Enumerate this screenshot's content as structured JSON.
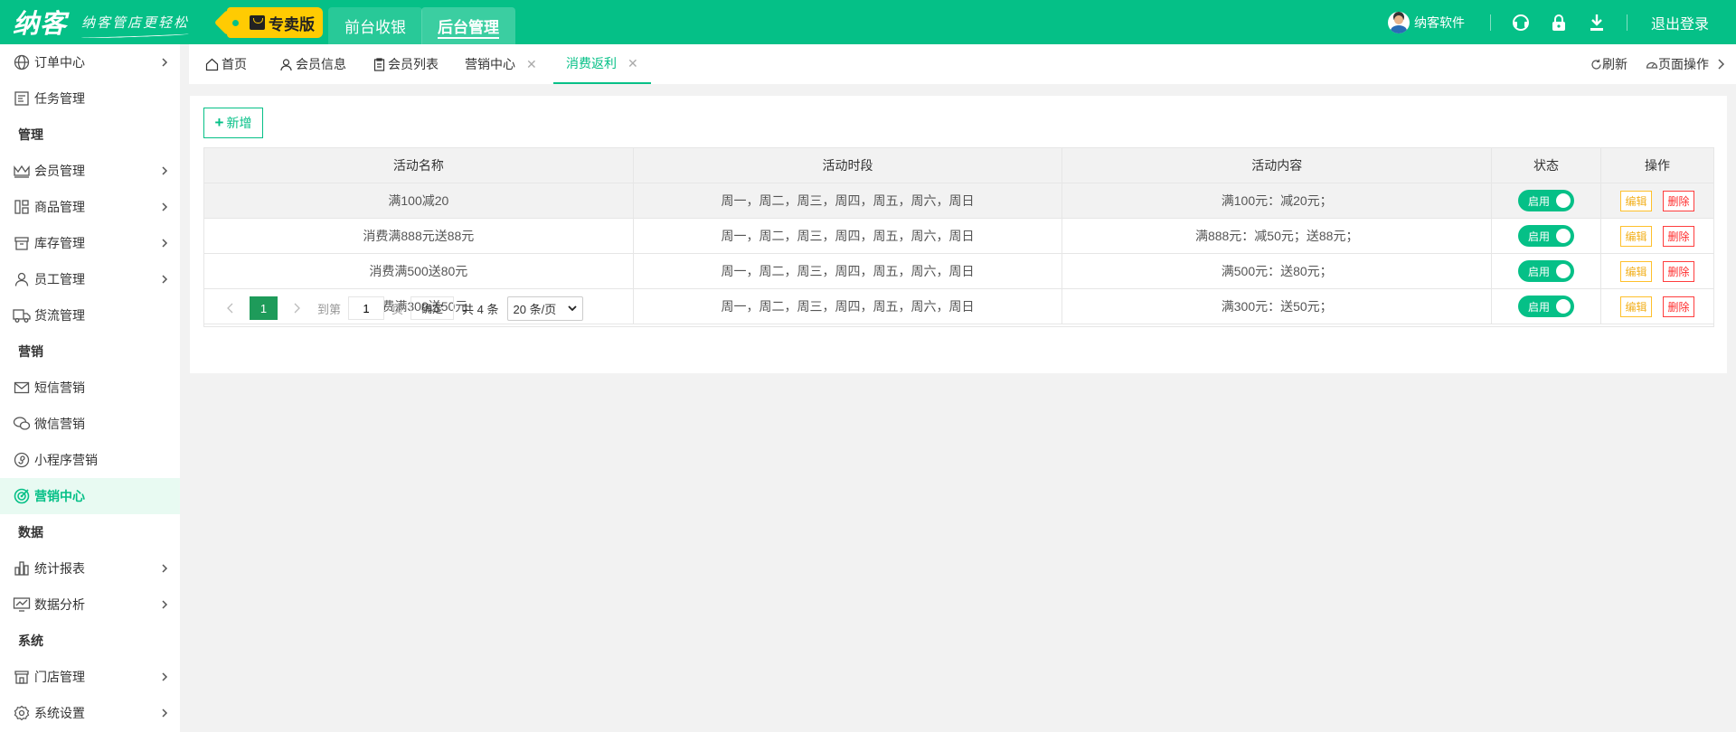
{
  "topbar": {
    "logo": "纳客",
    "slogan": "纳客管店更轻松",
    "edition": "专卖版",
    "tabs": [
      "前台收银",
      "后台管理"
    ],
    "user_name": "纳客软件",
    "logout": "退出登录",
    "accent_color": "#05c087"
  },
  "sidebar": {
    "items": [
      {
        "label": "订单中心",
        "icon": "globe-icon"
      },
      {
        "label": "任务管理",
        "icon": "task-icon"
      },
      {
        "label": "管理"
      },
      {
        "label": "会员管理",
        "icon": "crown-icon"
      },
      {
        "label": "商品管理",
        "icon": "goods-icon"
      },
      {
        "label": "库存管理",
        "icon": "inventory-icon"
      },
      {
        "label": "员工管理",
        "icon": "person-icon"
      },
      {
        "label": "货流管理",
        "icon": "truck-icon"
      },
      {
        "label": "营销"
      },
      {
        "label": "短信营销",
        "icon": "mail-icon"
      },
      {
        "label": "微信营销",
        "icon": "wechat-icon"
      },
      {
        "label": "小程序营销",
        "icon": "miniapp-icon"
      },
      {
        "label": "营销中心",
        "icon": "target-icon"
      },
      {
        "label": "数据"
      },
      {
        "label": "统计报表",
        "icon": "bar-chart-icon"
      },
      {
        "label": "数据分析",
        "icon": "line-chart-icon"
      },
      {
        "label": "系统"
      },
      {
        "label": "门店管理",
        "icon": "store-icon"
      },
      {
        "label": "系统设置",
        "icon": "gear-icon"
      }
    ]
  },
  "page_tabs": {
    "items": [
      "首页",
      "会员信息",
      "会员列表",
      "营销中心",
      "消费返利"
    ],
    "refresh": "刷新",
    "page_ops": "页面操作"
  },
  "toolbar": {
    "add_label": "新增"
  },
  "table": {
    "columns": [
      "活动名称",
      "活动时段",
      "活动内容",
      "状态",
      "操作"
    ],
    "rows": [
      {
        "name": "满100减20",
        "period": "周一，周二，周三，周四，周五，周六，周日",
        "content": "满100元：减20元；",
        "status": "启用"
      },
      {
        "name": "消费满888元送88元",
        "period": "周一，周二，周三，周四，周五，周六，周日",
        "content": "满888元：减50元；送88元；",
        "status": "启用"
      },
      {
        "name": "消费满500送80元",
        "period": "周一，周二，周三，周四，周五，周六，周日",
        "content": "满500元：送80元；",
        "status": "启用"
      },
      {
        "name": "消费满300送50元",
        "period": "周一，周二，周三，周四，周五，周六，周日",
        "content": "满300元：送50元；",
        "status": "启用"
      }
    ],
    "edit_label": "编辑",
    "delete_label": "删除"
  },
  "pagination": {
    "current_page": "1",
    "goto_label": "到第",
    "goto_value": "1",
    "page_unit": "页",
    "confirm": "确定",
    "total": "共 4 条",
    "page_size": "20 条/页"
  }
}
